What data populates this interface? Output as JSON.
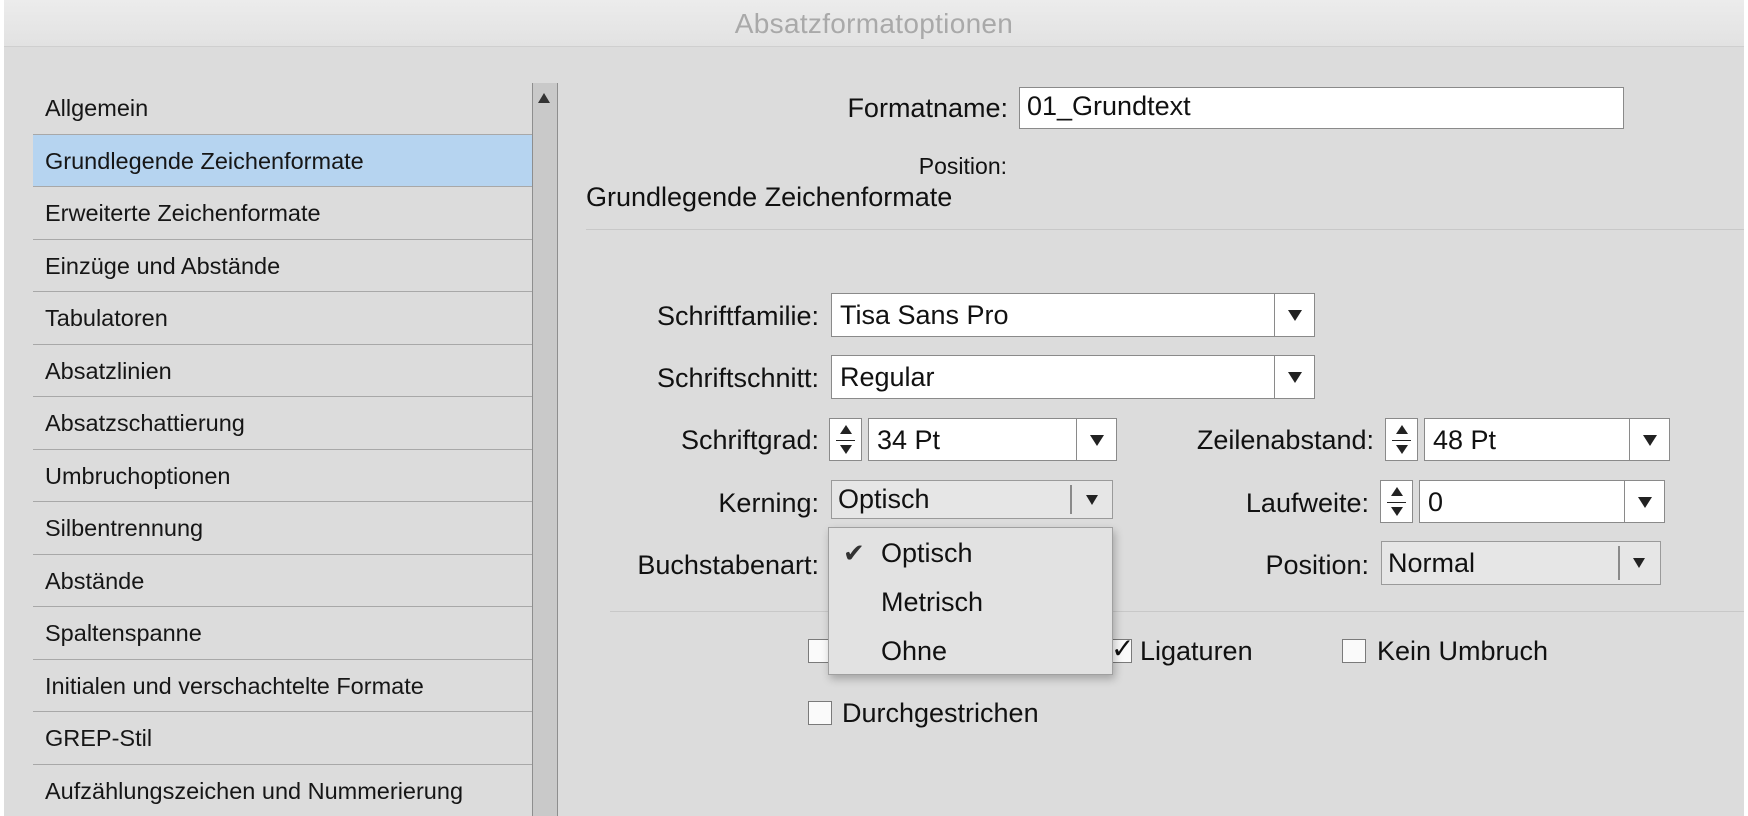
{
  "window": {
    "title": "Absatzformatoptionen"
  },
  "sidebar": {
    "items": [
      {
        "label": "Allgemein"
      },
      {
        "label": "Grundlegende Zeichenformate",
        "selected": true
      },
      {
        "label": "Erweiterte Zeichenformate"
      },
      {
        "label": "Einzüge und Abstände"
      },
      {
        "label": "Tabulatoren"
      },
      {
        "label": "Absatzlinien"
      },
      {
        "label": "Absatzschattierung"
      },
      {
        "label": "Umbruchoptionen"
      },
      {
        "label": "Silbentrennung"
      },
      {
        "label": "Abstände"
      },
      {
        "label": "Spaltenspanne"
      },
      {
        "label": "Initialen und verschachtelte Formate"
      },
      {
        "label": "GREP-Stil"
      },
      {
        "label": "Aufzählungszeichen und Nummerierung"
      }
    ]
  },
  "main": {
    "format_name_label": "Formatname:",
    "format_name_value": "01_Grundtext",
    "position_label": "Position:",
    "section_title": "Grundlegende Zeichenformate",
    "font_family": {
      "label": "Schriftfamilie:",
      "value": "Tisa Sans Pro"
    },
    "font_style": {
      "label": "Schriftschnitt:",
      "value": "Regular"
    },
    "font_size": {
      "label": "Schriftgrad:",
      "value": "34 Pt"
    },
    "leading": {
      "label": "Zeilenabstand:",
      "value": "48 Pt"
    },
    "kerning": {
      "label": "Kerning:",
      "value": "Optisch",
      "menu_open": true,
      "options": [
        {
          "label": "Optisch",
          "checked": true
        },
        {
          "label": "Metrisch",
          "checked": false
        },
        {
          "label": "Ohne",
          "checked": false
        }
      ],
      "check_glyph": "✔"
    },
    "tracking": {
      "label": "Laufweite:",
      "value": "0"
    },
    "case": {
      "label": "Buchstabenart:"
    },
    "position_select": {
      "label": "Position:",
      "value": "Normal"
    },
    "checkboxes": {
      "ligatures": {
        "label": "Ligaturen",
        "checked": true
      },
      "no_break": {
        "label": "Kein Umbruch",
        "checked": false
      },
      "strikethrough": {
        "label": "Durchgestrichen",
        "checked": false
      },
      "check_glyph": "✓"
    }
  },
  "colors": {
    "selection": "#b6d4f0",
    "panel_bg": "#dcdcdc",
    "title_text": "#a9a9a9"
  }
}
